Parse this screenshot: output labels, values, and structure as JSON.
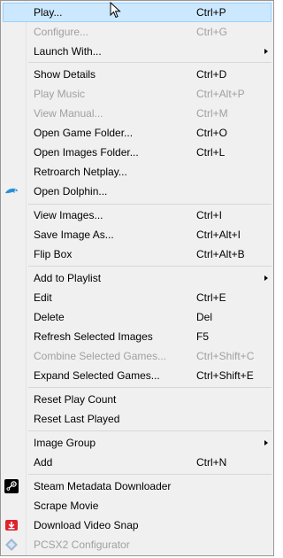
{
  "menu": {
    "items": [
      {
        "label": "Play...",
        "shortcut": "Ctrl+P"
      },
      {
        "label": "Configure...",
        "shortcut": "Ctrl+G"
      },
      {
        "label": "Launch With...",
        "shortcut": ""
      },
      {
        "label": "Show Details",
        "shortcut": "Ctrl+D"
      },
      {
        "label": "Play Music",
        "shortcut": "Ctrl+Alt+P"
      },
      {
        "label": "View Manual...",
        "shortcut": "Ctrl+M"
      },
      {
        "label": "Open Game Folder...",
        "shortcut": "Ctrl+O"
      },
      {
        "label": "Open Images Folder...",
        "shortcut": "Ctrl+L"
      },
      {
        "label": "Retroarch Netplay...",
        "shortcut": ""
      },
      {
        "label": "Open Dolphin...",
        "shortcut": ""
      },
      {
        "label": "View Images...",
        "shortcut": "Ctrl+I"
      },
      {
        "label": "Save Image As...",
        "shortcut": "Ctrl+Alt+I"
      },
      {
        "label": "Flip Box",
        "shortcut": "Ctrl+Alt+B"
      },
      {
        "label": "Add to Playlist",
        "shortcut": ""
      },
      {
        "label": "Edit",
        "shortcut": "Ctrl+E"
      },
      {
        "label": "Delete",
        "shortcut": "Del"
      },
      {
        "label": "Refresh Selected Images",
        "shortcut": "F5"
      },
      {
        "label": "Combine Selected Games...",
        "shortcut": "Ctrl+Shift+C"
      },
      {
        "label": "Expand Selected Games...",
        "shortcut": "Ctrl+Shift+E"
      },
      {
        "label": "Reset Play Count",
        "shortcut": ""
      },
      {
        "label": "Reset Last Played",
        "shortcut": ""
      },
      {
        "label": "Image Group",
        "shortcut": ""
      },
      {
        "label": "Add",
        "shortcut": "Ctrl+N"
      },
      {
        "label": "Steam Metadata Downloader",
        "shortcut": ""
      },
      {
        "label": "Scrape Movie",
        "shortcut": ""
      },
      {
        "label": "Download Video Snap",
        "shortcut": ""
      },
      {
        "label": "PCSX2 Configurator",
        "shortcut": ""
      }
    ]
  },
  "colors": {
    "highlight_bg": "#cce8ff",
    "highlight_border": "#99d1ff",
    "disabled_text": "#a0a0a0",
    "dolphin_icon": "#2a8fd6",
    "steam_icon": "#000000",
    "download_icon": "#e0222a",
    "pcsx2_icon": "#9fb8d8"
  },
  "icons": {
    "dolphin": "dolphin-icon",
    "steam": "steam-icon",
    "download": "download-video-icon",
    "pcsx2": "pcsx2-icon",
    "cursor": "mouse-cursor-icon"
  }
}
